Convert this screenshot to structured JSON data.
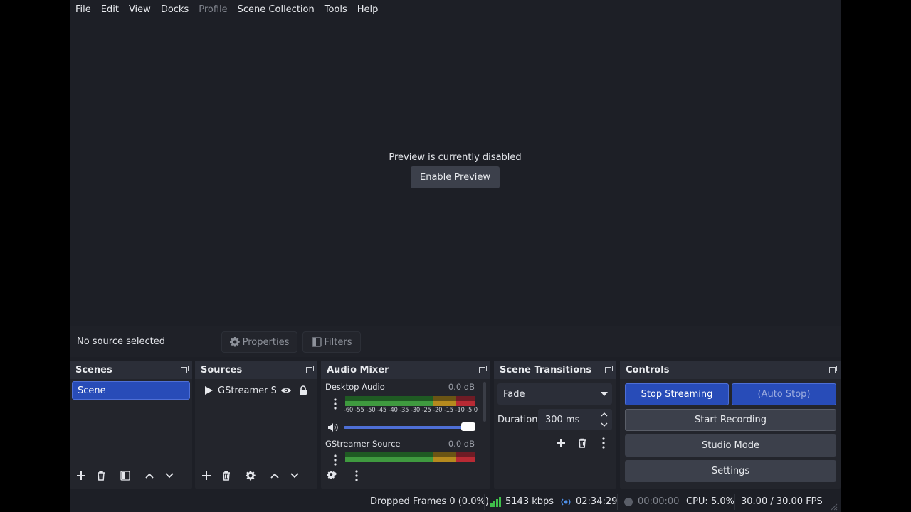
{
  "menu": [
    "File",
    "Edit",
    "View",
    "Docks",
    "Profile",
    "Scene Collection",
    "Tools",
    "Help"
  ],
  "preview": {
    "message": "Preview is currently disabled",
    "enable_button": "Enable Preview"
  },
  "source_bar": {
    "no_source": "No source selected",
    "properties": "Properties",
    "filters": "Filters"
  },
  "scenes": {
    "title": "Scenes",
    "items": [
      "Scene"
    ]
  },
  "sources": {
    "title": "Sources",
    "items": [
      "GStreamer Sc"
    ]
  },
  "audio_mixer": {
    "title": "Audio Mixer",
    "channels": [
      {
        "name": "Desktop Audio",
        "db": "0.0 dB",
        "volume": 1.0
      },
      {
        "name": "GStreamer Source",
        "db": "0.0 dB"
      }
    ],
    "scale": [
      "-60",
      "-55",
      "-50",
      "-45",
      "-40",
      "-35",
      "-30",
      "-25",
      "-20",
      "-15",
      "-10",
      "-5",
      "0"
    ]
  },
  "transitions": {
    "title": "Scene Transitions",
    "selected": "Fade",
    "duration_label": "Duration",
    "duration_value": "300 ms"
  },
  "controls": {
    "title": "Controls",
    "stop_streaming": "Stop Streaming",
    "auto_stop": "(Auto Stop)",
    "start_recording": "Start Recording",
    "studio_mode": "Studio Mode",
    "settings": "Settings"
  },
  "status": {
    "dropped_frames": "Dropped Frames 0 (0.0%)",
    "bitrate": "5143 kbps",
    "stream_time": "02:34:29",
    "record_time": "00:00:00",
    "cpu": "CPU: 5.0%",
    "fps": "30.00 / 30.00 FPS"
  },
  "colors": {
    "accent": "#284cb8",
    "meter_green": "#3f9a3f",
    "meter_yellow": "#b58a1e",
    "meter_red": "#b82a34"
  }
}
